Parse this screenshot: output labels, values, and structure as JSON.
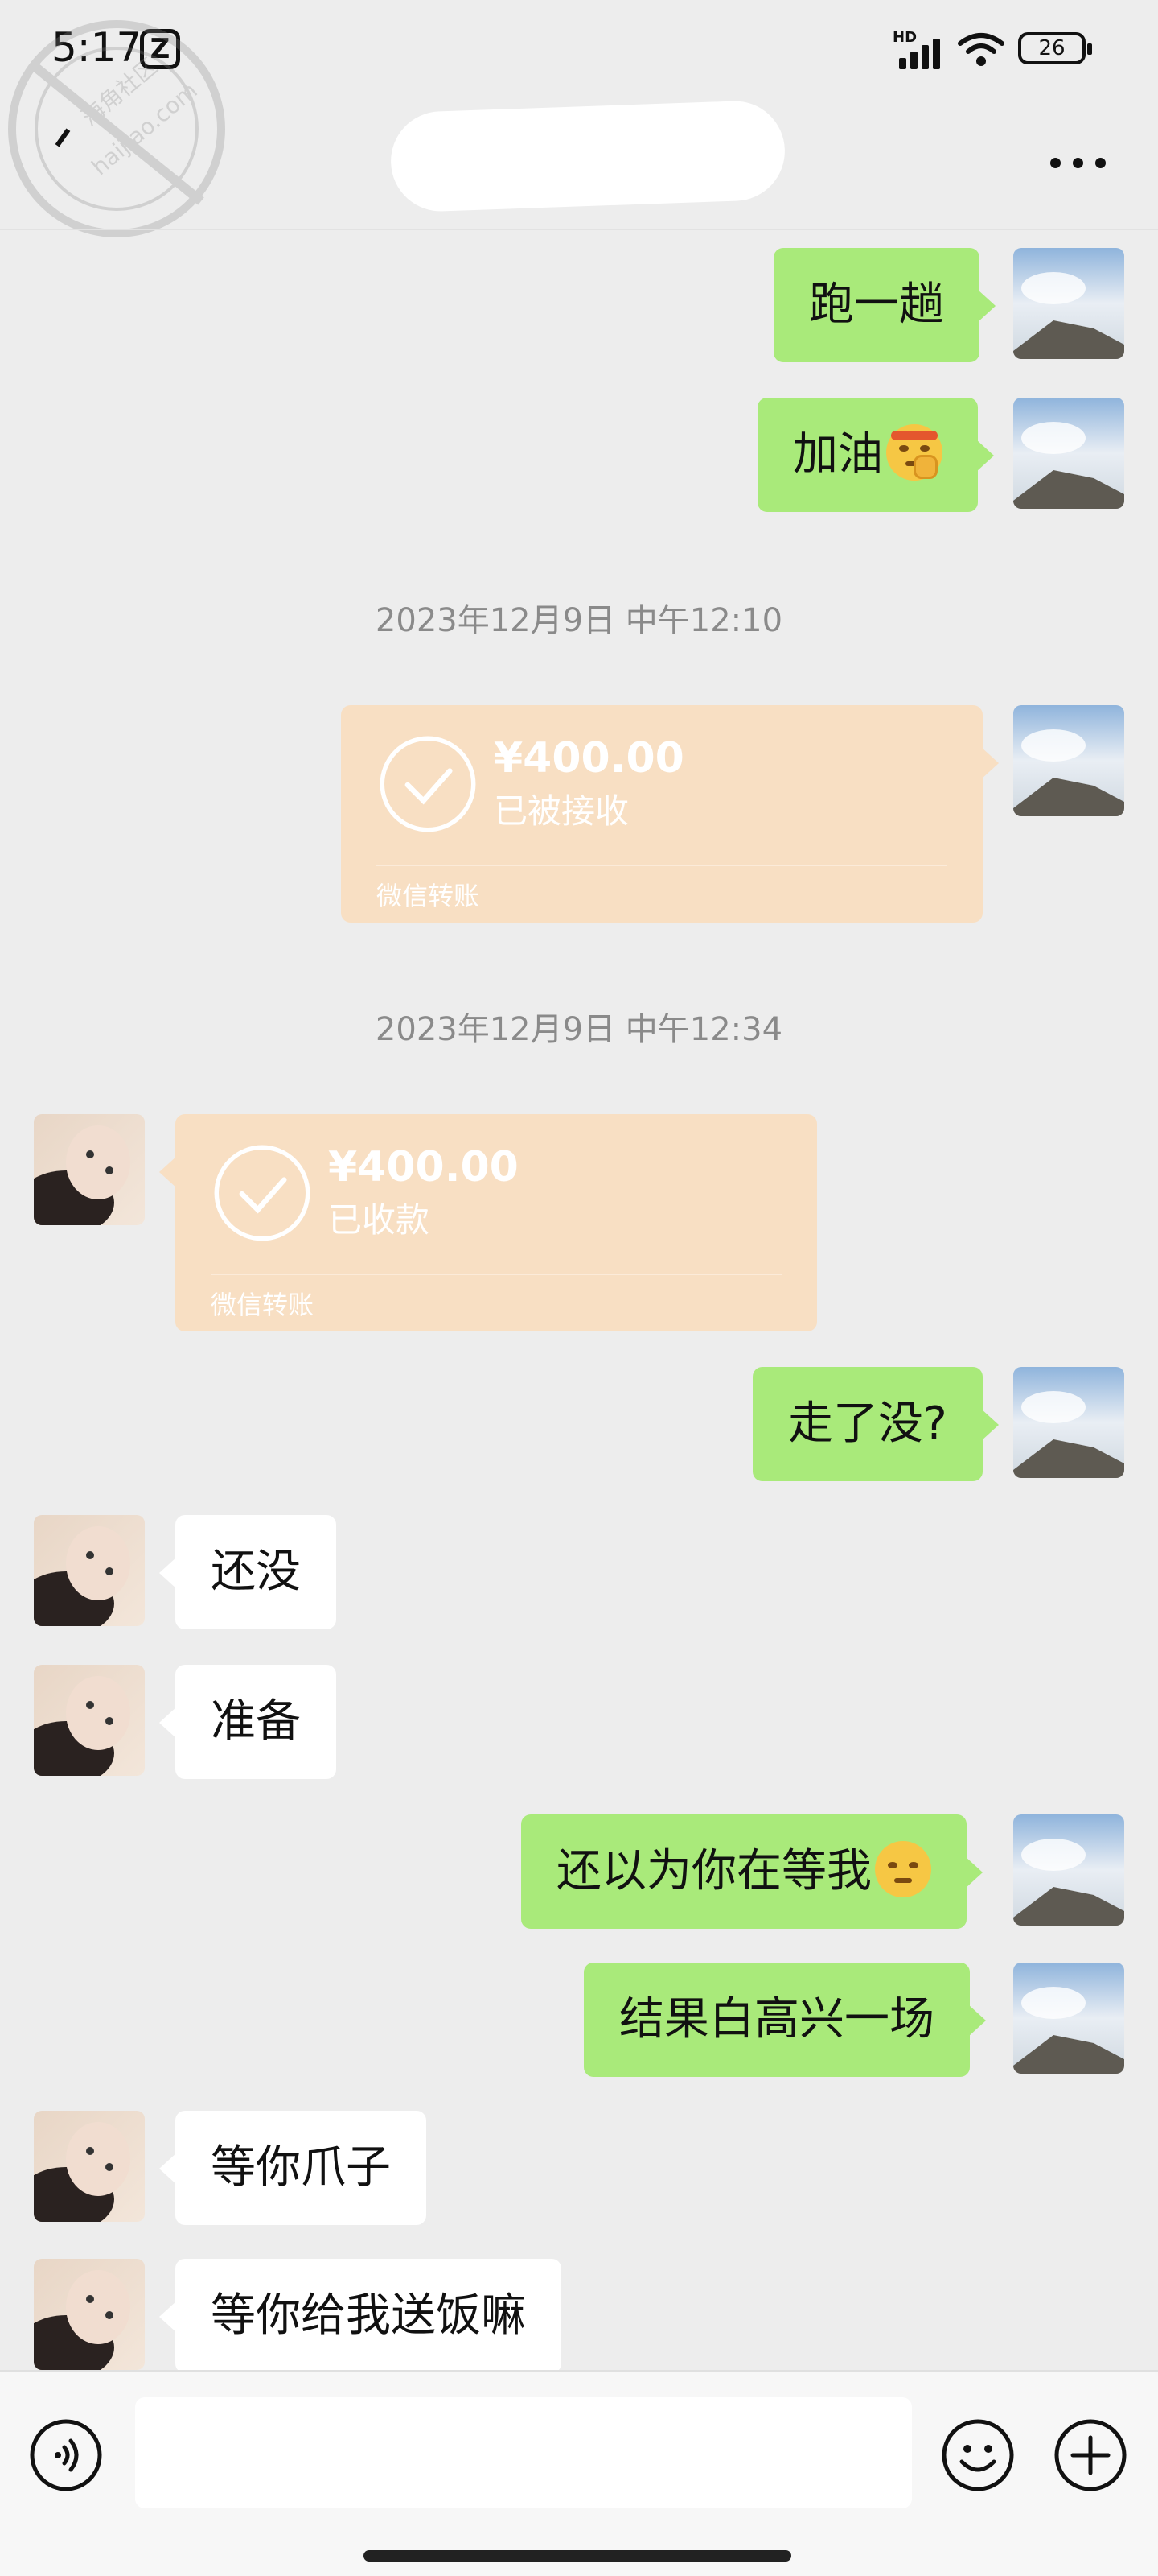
{
  "status_bar": {
    "time": "5:17",
    "network_badge": "HD",
    "battery": "26",
    "icons": [
      "app-notification-icon",
      "signal-icon",
      "wifi-icon",
      "battery-icon"
    ]
  },
  "watermark": {
    "line1": "海角社区",
    "line2": "haijiao.com"
  },
  "header": {
    "icons": [
      "back-icon",
      "more-icon"
    ]
  },
  "colors": {
    "outgoing_bubble": "#a9ea7a",
    "incoming_bubble": "#ffffff",
    "transfer_card": "#f8dfc3",
    "background": "#ededed"
  },
  "messages": [
    {
      "id": "m1",
      "side": "out",
      "text": "跑一趟"
    },
    {
      "id": "m2",
      "side": "out",
      "text": "加油",
      "emoji": "fist-headband-emoji"
    },
    {
      "id": "ts1",
      "type": "timestamp",
      "text": "2023年12月9日 中午12:10"
    },
    {
      "id": "t1",
      "side": "out",
      "type": "transfer",
      "amount": "¥400.00",
      "status": "已被接收",
      "label": "微信转账"
    },
    {
      "id": "ts2",
      "type": "timestamp",
      "text": "2023年12月9日 中午12:34"
    },
    {
      "id": "t2",
      "side": "in",
      "type": "transfer",
      "amount": "¥400.00",
      "status": "已收款",
      "label": "微信转账"
    },
    {
      "id": "m3",
      "side": "out",
      "text": "走了没?"
    },
    {
      "id": "m4",
      "side": "in",
      "text": "还没"
    },
    {
      "id": "m5",
      "side": "in",
      "text": "准备"
    },
    {
      "id": "m6",
      "side": "out",
      "text": "还以为你在等我",
      "emoji": "pouting-face-emoji"
    },
    {
      "id": "m7",
      "side": "out",
      "text": "结果白高兴一场"
    },
    {
      "id": "m8",
      "side": "in",
      "text": "等你爪子"
    },
    {
      "id": "m9",
      "side": "in",
      "text": "等你给我送饭嘛"
    }
  ],
  "input_bar": {
    "value": "",
    "icons": [
      "voice-icon",
      "emoji-icon",
      "plus-icon"
    ]
  }
}
